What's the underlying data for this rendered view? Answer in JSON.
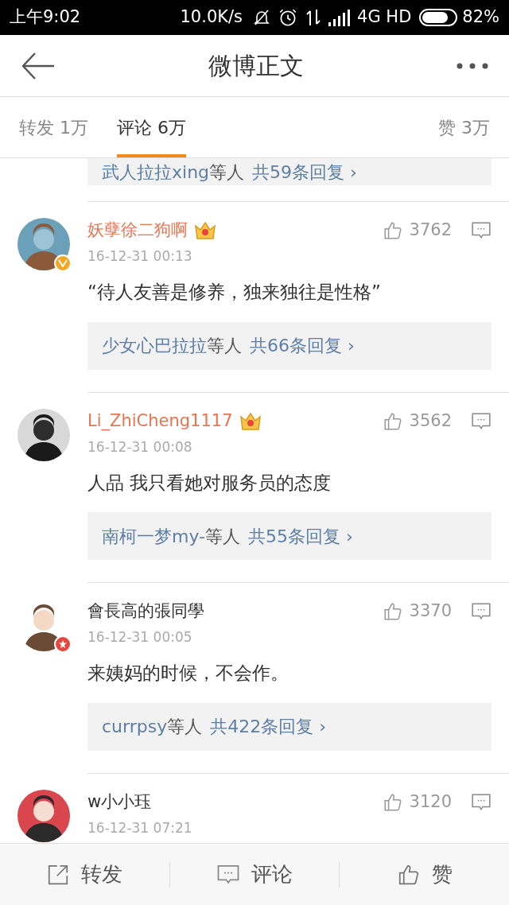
{
  "status_bar": {
    "time": "上午9:02",
    "speed": "10.0K/s",
    "network": "4G HD",
    "battery": "82%"
  },
  "header": {
    "title": "微博正文"
  },
  "tabs": [
    {
      "label": "转发 1万",
      "selected": false
    },
    {
      "label": "评论 6万",
      "selected": true
    },
    {
      "label": "赞 3万",
      "selected": false
    }
  ],
  "top_reply": {
    "users": "武人拉拉xing",
    "suffix": "等人",
    "count": "共59条回复 ›"
  },
  "comments": [
    {
      "name": "妖孽徐二狗啊",
      "vip": true,
      "badge": {
        "kind": "verified",
        "color": "#f5a623"
      },
      "likes": "3762",
      "date": "16-12-31 00:13",
      "text": "“待人友善是修养，独来独往是性格”",
      "reply": {
        "users": "少女心巴拉拉",
        "suffix": "等人",
        "count": "共66条回复 ›"
      }
    },
    {
      "name": "Li_ZhiCheng1117",
      "vip": true,
      "likes": "3562",
      "date": "16-12-31 00:08",
      "text": "人品 我只看她对服务员的态度",
      "reply": {
        "users": "南柯一梦my-",
        "suffix": "等人",
        "count": "共55条回复 ›"
      }
    },
    {
      "name": "會長高的張同學",
      "vip": false,
      "badge": {
        "kind": "star",
        "color": "#e8453c"
      },
      "likes": "3370",
      "date": "16-12-31 00:05",
      "text": "来姨妈的时候，不会作。",
      "reply": {
        "users": "currpsy",
        "suffix": "等人",
        "count": "共422条回复 ›"
      }
    },
    {
      "name": "w小小珏",
      "vip": false,
      "likes": "3120",
      "date": "16-12-31 07:21"
    }
  ],
  "bottom_bar": [
    "转发",
    "评论",
    "赞"
  ]
}
